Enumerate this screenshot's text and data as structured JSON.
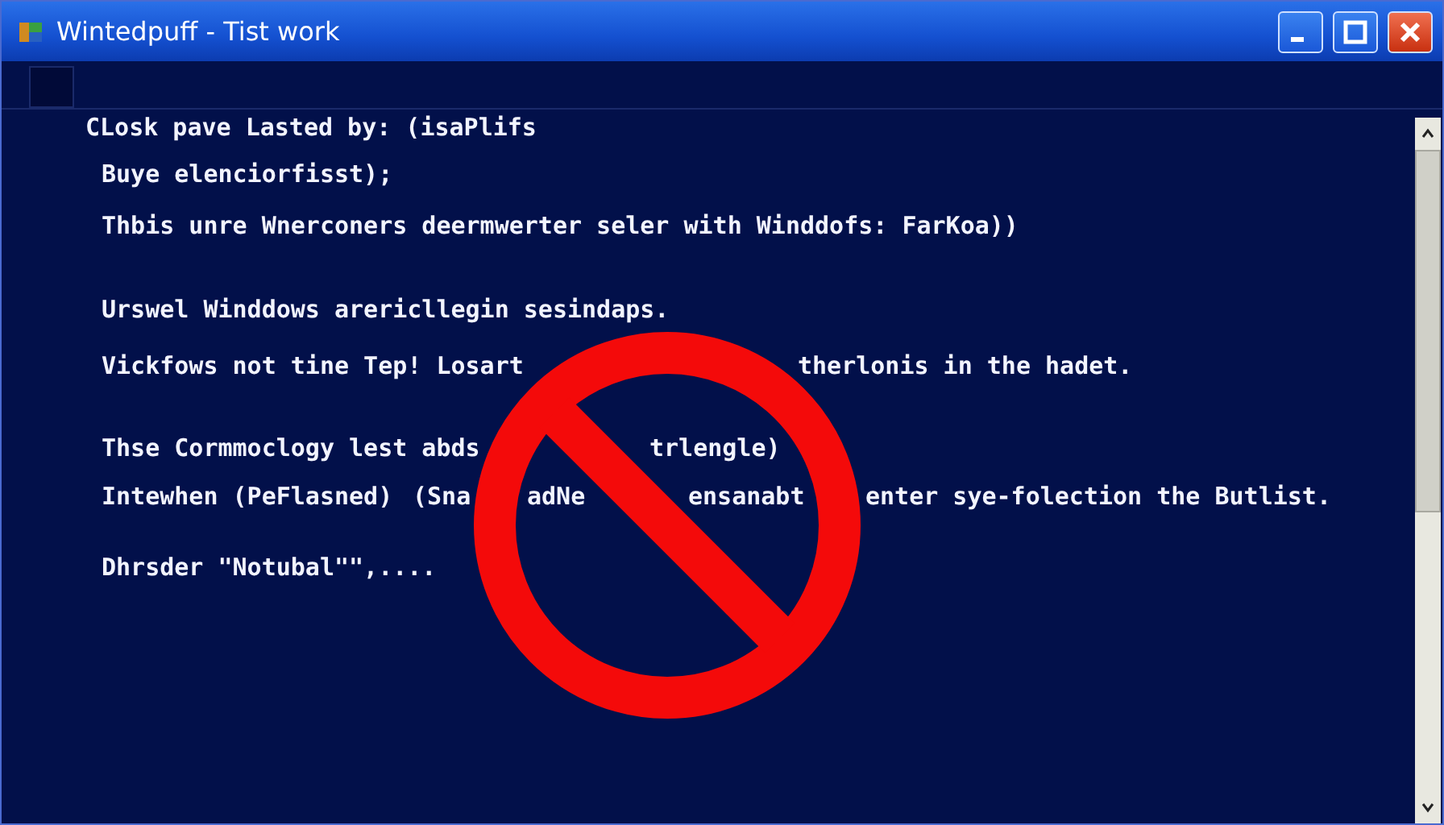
{
  "window": {
    "title": "Wintedpuff - Tist work"
  },
  "lines": [
    {
      "segments": [
        "CLosk pave Lasted by: (isaPlifs"
      ]
    },
    {
      "segments": [
        "Buye elenciorfisst);"
      ]
    },
    {
      "segments": [
        "Thbis unre Wnerconers deermwerter seler with Winddofs: FarKoa))"
      ]
    },
    {
      "segments": [
        "Urswel Winddows arericllegin sesindaps."
      ]
    },
    {
      "segments": [
        "Vickfows not tine Tep! Losart",
        "therlonis in the hadet."
      ]
    },
    {
      "segments": [
        "Thse Cormmoclogy lest abds",
        "trlengle)"
      ]
    },
    {
      "segments": [
        "Intewhen (PeFlasned)",
        "(Sna",
        "adNe",
        "ensanabt",
        "enter sye-folection the Butlist."
      ]
    },
    {
      "segments": [
        "Dhrsder \"Notubal\"\",...."
      ]
    }
  ]
}
